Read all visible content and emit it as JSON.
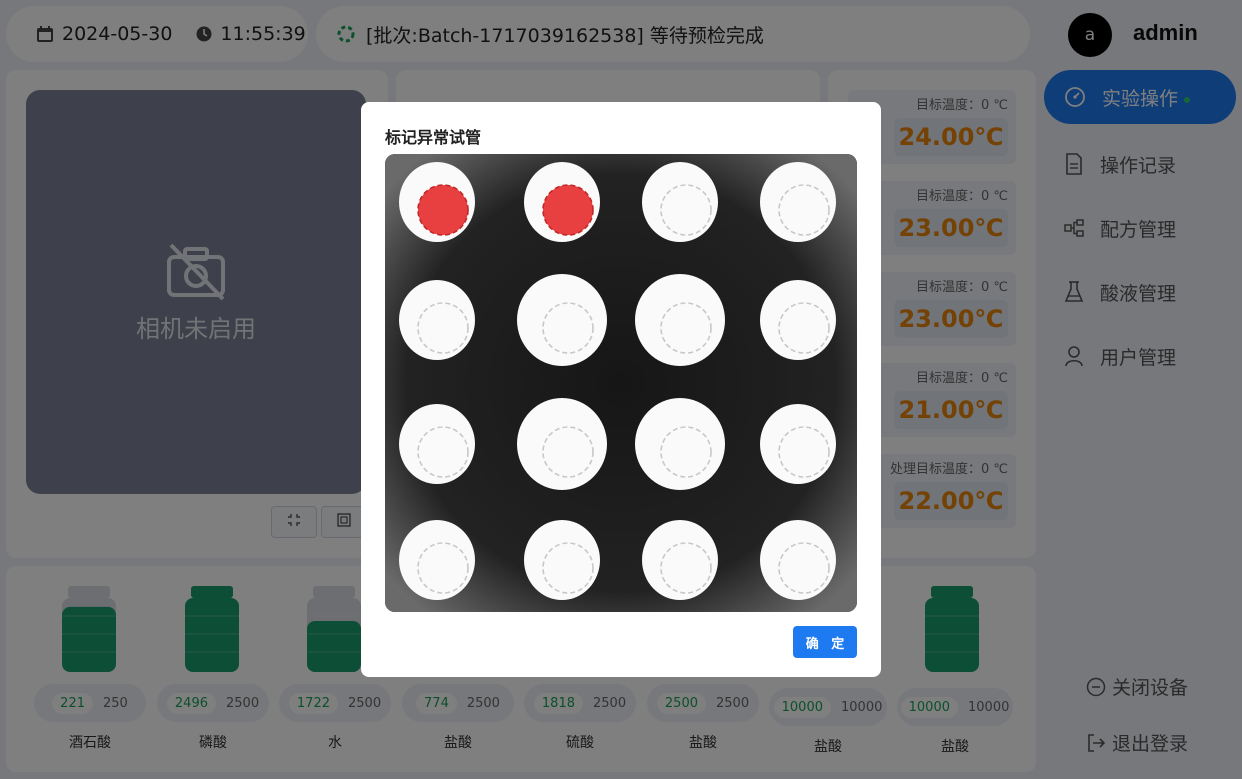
{
  "header": {
    "date": "2024-05-30",
    "time": "11:55:39",
    "status": "[批次:Batch-1717039162538] 等待预检完成"
  },
  "user": {
    "initial": "a",
    "name": "admin"
  },
  "camera": {
    "placeholder": "相机未启用"
  },
  "temperatures": [
    {
      "label": "目标温度：0 ℃",
      "value": "24.00℃"
    },
    {
      "label": "目标温度：0 ℃",
      "value": "23.00℃"
    },
    {
      "label": "目标温度：0 ℃",
      "value": "23.00℃"
    },
    {
      "label": "目标温度：0 ℃",
      "value": "21.00℃"
    },
    {
      "label": "处理目标温度：0 ℃",
      "value": "22.00℃"
    }
  ],
  "nav": [
    {
      "label": "实验操作",
      "icon": "dashboard-icon"
    },
    {
      "label": "操作记录",
      "icon": "document-icon"
    },
    {
      "label": "配方管理",
      "icon": "formula-icon"
    },
    {
      "label": "酸液管理",
      "icon": "flask-icon"
    },
    {
      "label": "用户管理",
      "icon": "user-icon"
    }
  ],
  "footer": {
    "shutdown": "关闭设备",
    "logout": "退出登录"
  },
  "reagents": [
    {
      "name": "酒石酸",
      "current": "221",
      "capacity": "250",
      "level": 0.88
    },
    {
      "name": "磷酸",
      "current": "2496",
      "capacity": "2500",
      "level": 1.0
    },
    {
      "name": "水",
      "current": "1722",
      "capacity": "2500",
      "level": 0.69
    },
    {
      "name": "盐酸",
      "current": "774",
      "capacity": "2500",
      "level": 0.31
    },
    {
      "name": "硫酸",
      "current": "1818",
      "capacity": "2500",
      "level": 0.73
    },
    {
      "name": "盐酸",
      "current": "2500",
      "capacity": "2500",
      "level": 1.0
    },
    {
      "name": "盐酸",
      "current": "10000",
      "capacity": "10000",
      "level": 1.0
    },
    {
      "name": "盐酸",
      "current": "10000",
      "capacity": "10000",
      "level": 1.0
    }
  ],
  "modal": {
    "title": "标记异常试管",
    "confirm": "确 定",
    "tubes_marked": [
      1,
      2
    ],
    "tube_count": 16
  },
  "colors": {
    "primary": "#1e7af0",
    "temperature": "#e8840b",
    "marked": "#e84040",
    "bottle": "#1a9d6f"
  }
}
